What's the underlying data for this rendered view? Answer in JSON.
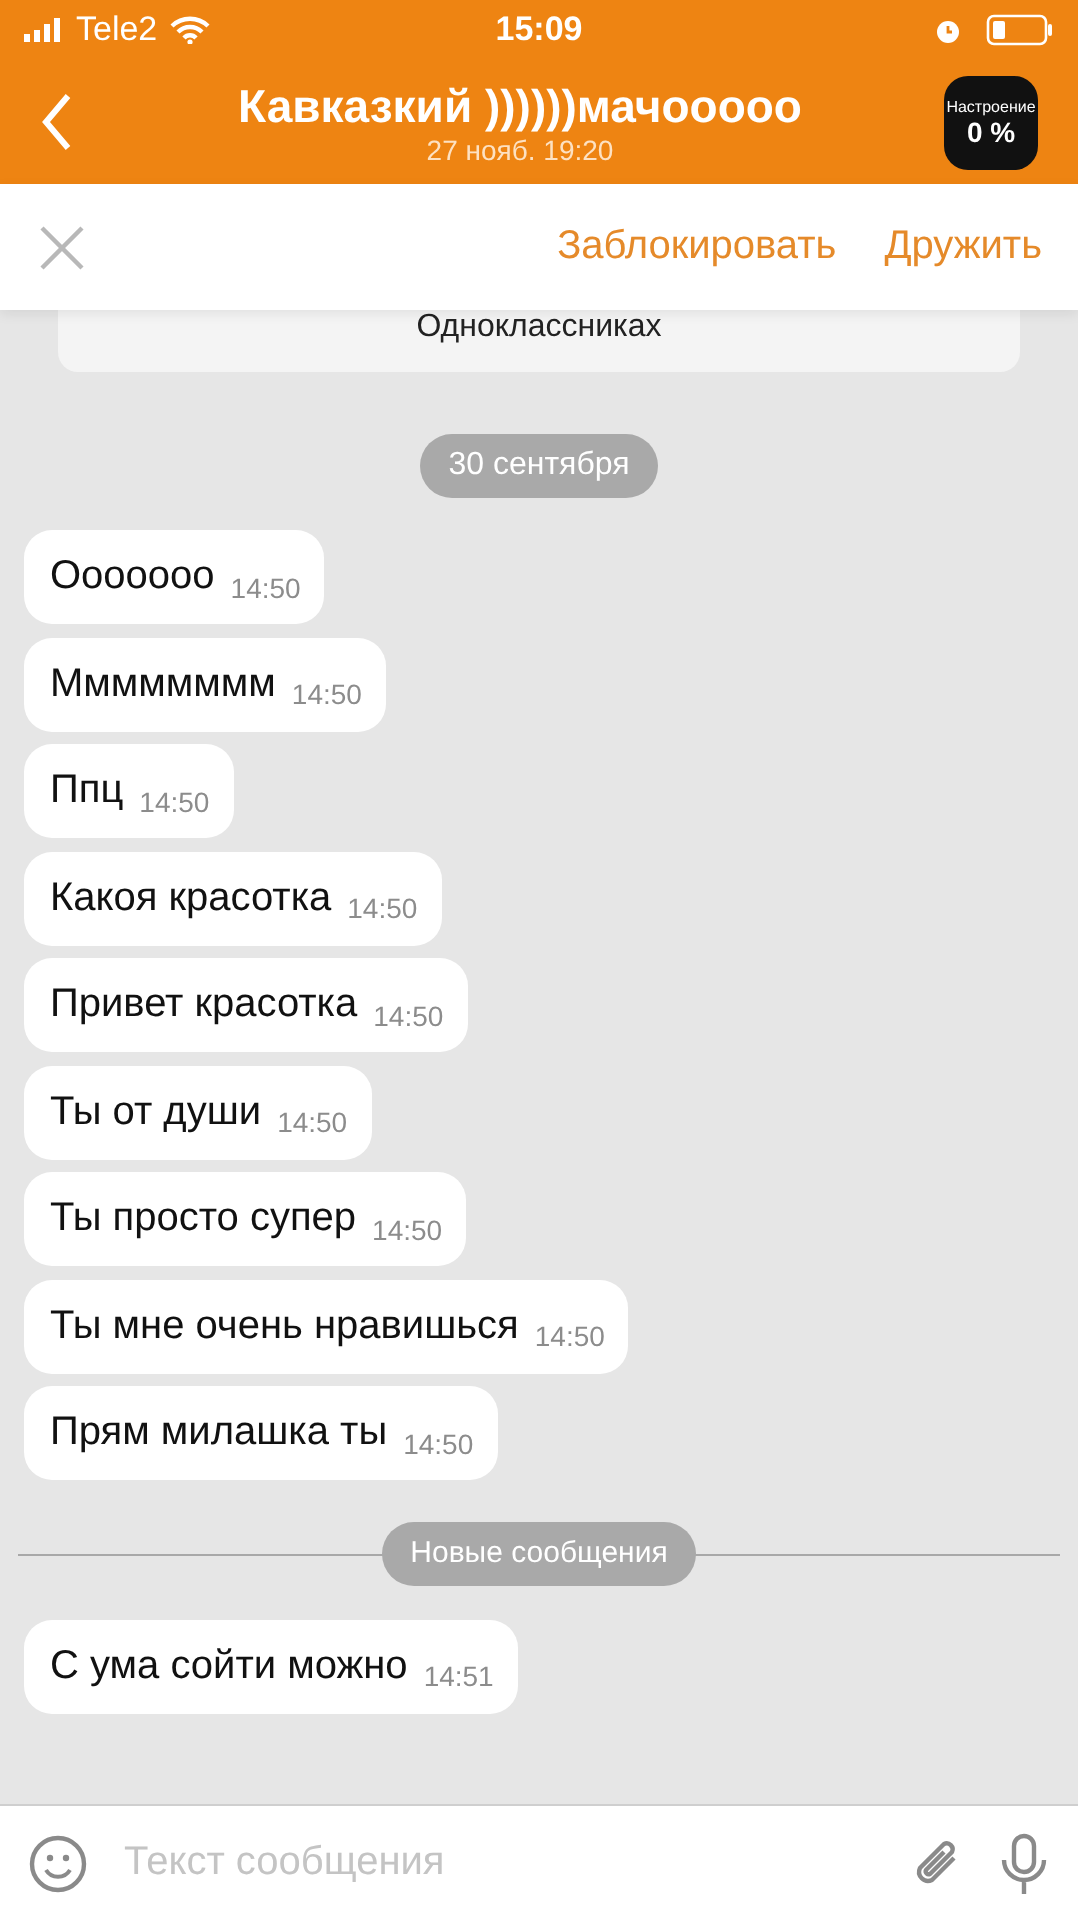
{
  "status_bar": {
    "carrier": "Tele2",
    "time": "15:09"
  },
  "header": {
    "title": "Кавказкий ))))))мачооооо",
    "subtitle": "27 нояб. 19:20",
    "mood": {
      "label": "Настроение",
      "value": "0 %"
    }
  },
  "actions": {
    "block": "Заблокировать",
    "friend": "Дружить"
  },
  "info_card": {
    "text": "Одноклассниках"
  },
  "date": "30 сентября",
  "messages": [
    {
      "text": "Ооооооо",
      "time": "14:50"
    },
    {
      "text": "Мммммммм",
      "time": "14:50"
    },
    {
      "text": "Ппц",
      "time": "14:50"
    },
    {
      "text": "Какоя красотка",
      "time": "14:50"
    },
    {
      "text": "Привет красотка",
      "time": "14:50"
    },
    {
      "text": "Ты от души",
      "time": "14:50"
    },
    {
      "text": "Ты просто супер",
      "time": "14:50"
    },
    {
      "text": "Ты мне очень нравишься",
      "time": "14:50"
    },
    {
      "text": "Прям милашка ты",
      "time": "14:50"
    }
  ],
  "new_divider": "Новые сообщения",
  "new_messages": [
    {
      "text": "С ума сойти можно",
      "time": "14:51"
    }
  ],
  "composer": {
    "placeholder": "Текст сообщения"
  }
}
